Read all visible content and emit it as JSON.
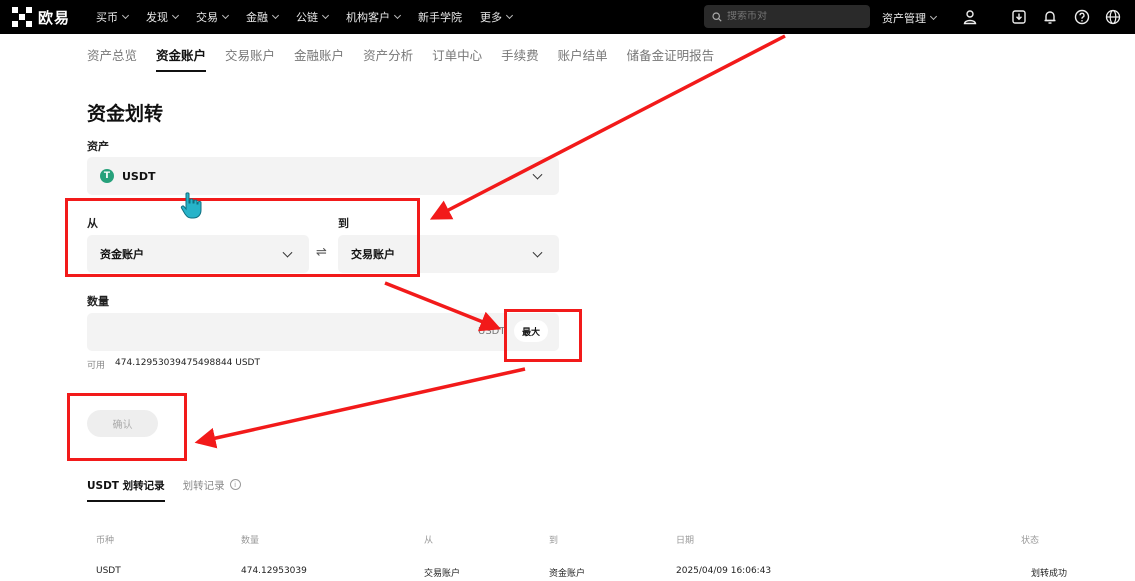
{
  "topbar": {
    "logo": "欧易",
    "nav": [
      {
        "label": "买币"
      },
      {
        "label": "发现"
      },
      {
        "label": "交易"
      },
      {
        "label": "金融"
      },
      {
        "label": "公链"
      },
      {
        "label": "机构客户"
      },
      {
        "label": "新手学院"
      },
      {
        "label": "更多"
      }
    ],
    "search_placeholder": "搜索币对",
    "asset_management": "资产管理",
    "icons": [
      "user-icon",
      "download-icon",
      "bell-icon",
      "help-icon",
      "globe-icon"
    ]
  },
  "subtabs": [
    {
      "label": "资产总览"
    },
    {
      "label": "资金账户",
      "active": true
    },
    {
      "label": "交易账户"
    },
    {
      "label": "金融账户"
    },
    {
      "label": "资产分析"
    },
    {
      "label": "订单中心"
    },
    {
      "label": "手续费"
    },
    {
      "label": "账户结单"
    },
    {
      "label": "储备金证明报告"
    }
  ],
  "transfer": {
    "title": "资金划转",
    "asset_label": "资产",
    "asset_value": "USDT",
    "asset_icon_letter": "T",
    "from_label": "从",
    "from_value": "资金账户",
    "to_label": "到",
    "to_value": "交易账户",
    "swap_symbol": "⇌",
    "amount_label": "数量",
    "amount_unit": "USDT",
    "max_label": "最大",
    "available_label": "可用",
    "available_value": "474.12953039475498844 USDT",
    "confirm_label": "确认"
  },
  "records": {
    "tabs": [
      {
        "label": "USDT 划转记录",
        "active": true
      },
      {
        "label": "划转记录"
      }
    ],
    "columns": [
      "币种",
      "数量",
      "从",
      "到",
      "日期",
      "状态"
    ],
    "rows": [
      [
        "USDT",
        "474.12953039",
        "交易账户",
        "资金账户",
        "2025/04/09 16:06:43",
        "划转成功"
      ]
    ]
  },
  "annotation_color": "#f21a1a"
}
